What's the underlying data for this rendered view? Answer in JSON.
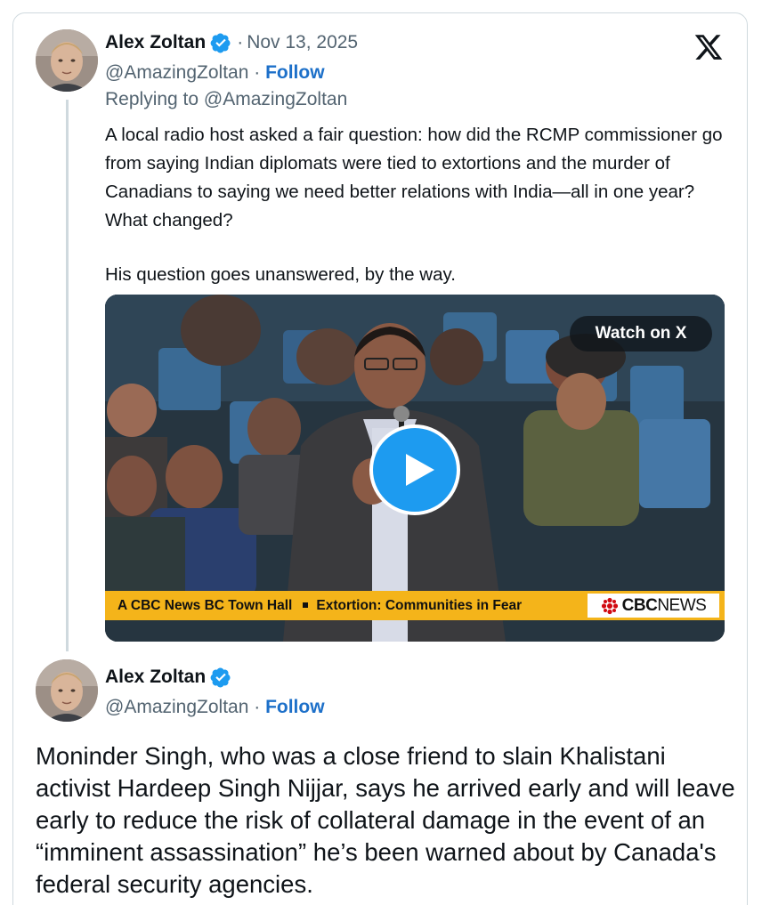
{
  "platform": {
    "logo_icon": "x-logo-icon"
  },
  "tweets": [
    {
      "author": {
        "display_name": "Alex Zoltan",
        "handle": "@AmazingZoltan",
        "verified_icon": "verified-badge-icon",
        "avatar_icon": "avatar-photo"
      },
      "separator": "·",
      "date": "Nov 13, 2025",
      "follow_label": "Follow",
      "replying_to": "Replying to @AmazingZoltan",
      "text_paragraphs": [
        "A local radio host asked a fair question: how did the RCMP commissioner go from saying Indian diplomats were tied to extortions and the murder of Canadians to saying we need better relations with India—all in one year? What changed?",
        "His question goes unanswered, by the way."
      ],
      "media": {
        "type": "video",
        "watch_label": "Watch on X",
        "play_icon": "play-icon",
        "lower_third_left": "A CBC News BC Town Hall",
        "lower_third_right": "Extortion: Communities in Fear",
        "broadcaster_bold": "CBC",
        "broadcaster_regular": "NEWS"
      }
    },
    {
      "author": {
        "display_name": "Alex Zoltan",
        "handle": "@AmazingZoltan",
        "verified_icon": "verified-badge-icon",
        "avatar_icon": "avatar-photo"
      },
      "separator": "·",
      "follow_label": "Follow",
      "text": "Moninder Singh, who was a close friend to slain Khalistani activist Hardeep Singh Nijjar, says he arrived early and will leave early to reduce the risk of collateral damage in the event of an “imminent assassination” he’s been warned about by Canada's federal security agencies."
    }
  ],
  "colors": {
    "link_blue": "#1d70c9",
    "verified_blue": "#1d9bf0",
    "muted_text": "#536471",
    "lower_third_yellow": "#f4b41a",
    "thread_line": "#cfd9de"
  }
}
